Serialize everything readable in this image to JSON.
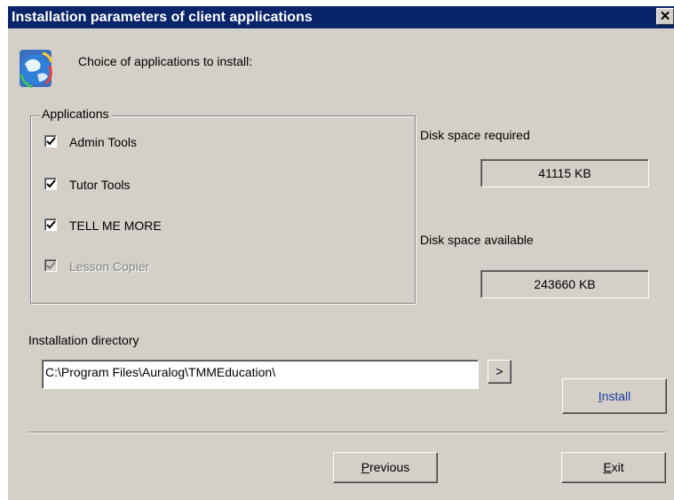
{
  "window": {
    "title": "Installation parameters of client applications",
    "close_glyph": "✕"
  },
  "header": {
    "icon": "globe-icon",
    "text": "Choice of applications to install:"
  },
  "applications": {
    "legend": "Applications",
    "items": [
      {
        "label": "Admin Tools",
        "checked": true,
        "enabled": true
      },
      {
        "label": "Tutor Tools",
        "checked": true,
        "enabled": true
      },
      {
        "label": "TELL ME MORE",
        "checked": true,
        "enabled": true
      },
      {
        "label": "Lesson Copier",
        "checked": true,
        "enabled": false
      }
    ]
  },
  "disk": {
    "required_label": "Disk space required",
    "required_value": "41115 KB",
    "available_label": "Disk space available",
    "available_value": "243660 KB"
  },
  "directory": {
    "label": "Installation directory",
    "value": "C:\\Program Files\\Auralog\\TMMEducation\\",
    "browse_label": ">"
  },
  "buttons": {
    "install_mnemonic": "I",
    "install_rest": "nstall",
    "previous_mnemonic": "P",
    "previous_rest": "revious",
    "exit_mnemonic": "E",
    "exit_rest": "xit"
  },
  "colors": {
    "title_bar": "#0a246a",
    "face": "#d4d0c8",
    "install_text": "#1a3aa0"
  }
}
